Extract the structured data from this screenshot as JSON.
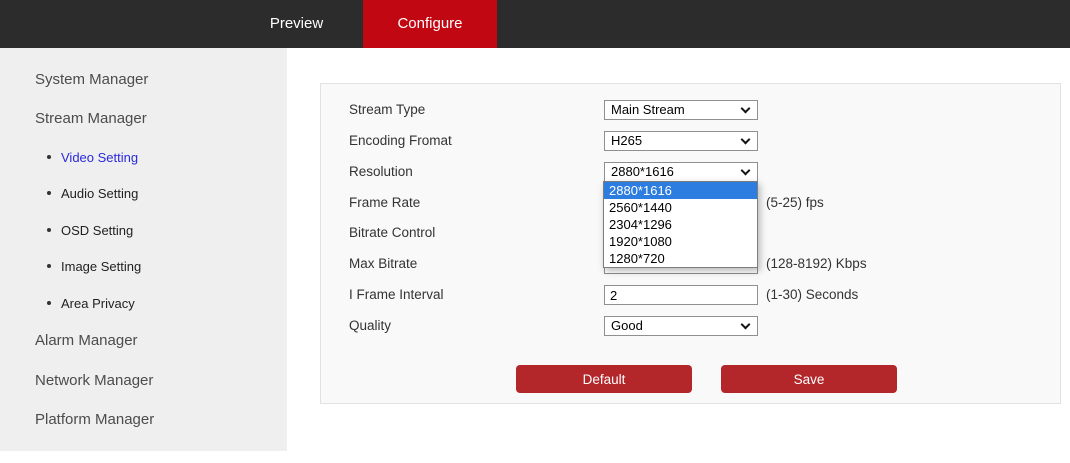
{
  "topbar": {
    "tabs": [
      {
        "label": "Preview",
        "active": false
      },
      {
        "label": "Configure",
        "active": true
      }
    ]
  },
  "sidebar": {
    "items": [
      {
        "label": "System Manager",
        "type": "main",
        "active": false
      },
      {
        "label": "Stream Manager",
        "type": "main",
        "active": false
      },
      {
        "label": "Video Setting",
        "type": "sub",
        "active": true
      },
      {
        "label": "Audio Setting",
        "type": "sub",
        "active": false
      },
      {
        "label": "OSD Setting",
        "type": "sub",
        "active": false
      },
      {
        "label": "Image Setting",
        "type": "sub",
        "active": false
      },
      {
        "label": "Area Privacy",
        "type": "sub",
        "active": false
      },
      {
        "label": "Alarm Manager",
        "type": "main",
        "active": false
      },
      {
        "label": "Network Manager",
        "type": "main",
        "active": false
      },
      {
        "label": "Platform Manager",
        "type": "main",
        "active": false
      }
    ]
  },
  "form": {
    "rows": [
      {
        "label": "Stream Type",
        "control": "select",
        "value": "Main Stream",
        "hint": ""
      },
      {
        "label": "Encoding Fromat",
        "control": "select",
        "value": "H265",
        "hint": ""
      },
      {
        "label": "Resolution",
        "control": "select",
        "value": "2880*1616",
        "hint": ""
      },
      {
        "label": "Frame Rate",
        "control": "select",
        "value": "",
        "hint": "(5-25) fps"
      },
      {
        "label": "Bitrate Control",
        "control": "select",
        "value": "",
        "hint": ""
      },
      {
        "label": "Max Bitrate",
        "control": "input",
        "value": "",
        "hint": "(128-8192) Kbps"
      },
      {
        "label": "I Frame Interval",
        "control": "input",
        "value": "2",
        "hint": "(1-30) Seconds"
      },
      {
        "label": "Quality",
        "control": "select",
        "value": "Good",
        "hint": ""
      }
    ],
    "buttons": {
      "default": "Default",
      "save": "Save"
    }
  },
  "resolution_dropdown": {
    "selected": "2880*1616",
    "options": [
      "2880*1616",
      "2560*1440",
      "2304*1296",
      "1920*1080",
      "1280*720"
    ]
  },
  "colors": {
    "topbar_bg": "#2c2c2c",
    "accent_red": "#c10711",
    "button_red": "#b3262a",
    "dropdown_highlight_blue": "#2d7de0",
    "active_link_blue": "#2929dd",
    "sidebar_bg": "#efefef",
    "panel_bg": "#f9f9f9"
  }
}
